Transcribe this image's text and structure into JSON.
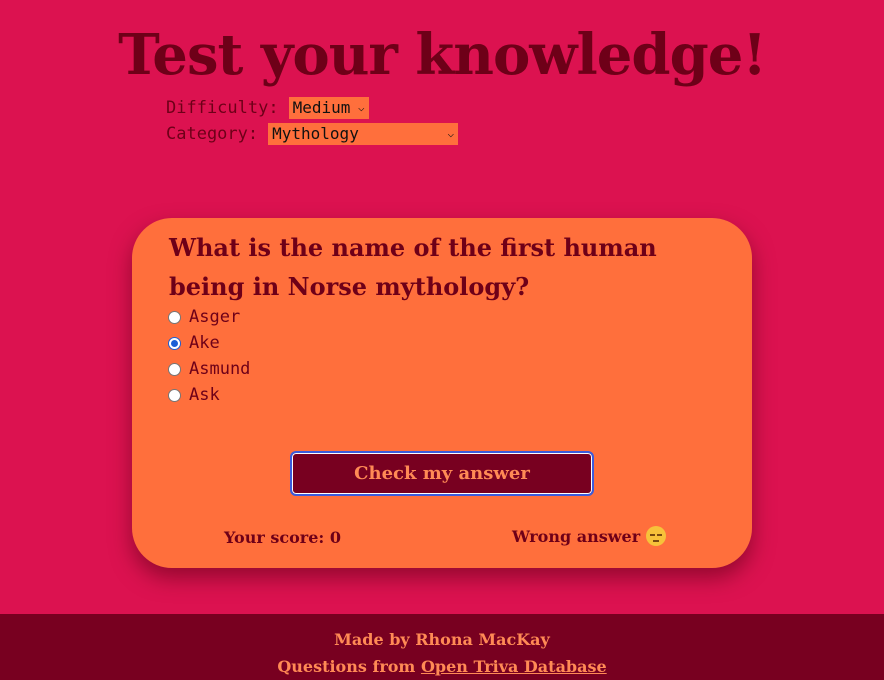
{
  "page": {
    "title": "Test your knowledge!"
  },
  "controls": {
    "difficulty_label": "Difficulty:",
    "difficulty_value": "Medium",
    "category_label": "Category:",
    "category_value": "Mythology"
  },
  "quiz": {
    "question": "What is the name of the first human being in Norse mythology?",
    "answers": [
      {
        "label": "Asger",
        "selected": false
      },
      {
        "label": "Ake",
        "selected": true
      },
      {
        "label": "Asmund",
        "selected": false
      },
      {
        "label": "Ask",
        "selected": false
      }
    ],
    "check_button_label": "Check my answer",
    "score_text": "Your score: 0",
    "feedback_text": "Wrong answer",
    "feedback_icon": "pensive-face-icon"
  },
  "footer": {
    "credit": "Made by Rhona MacKay",
    "source_prefix": "Questions from",
    "source_link": "Open Triva Database"
  },
  "colors": {
    "background": "#dc1250",
    "card": "#ff6f3c",
    "dark": "#6e0018",
    "button": "#780020",
    "accent_text": "#ff8a55"
  }
}
